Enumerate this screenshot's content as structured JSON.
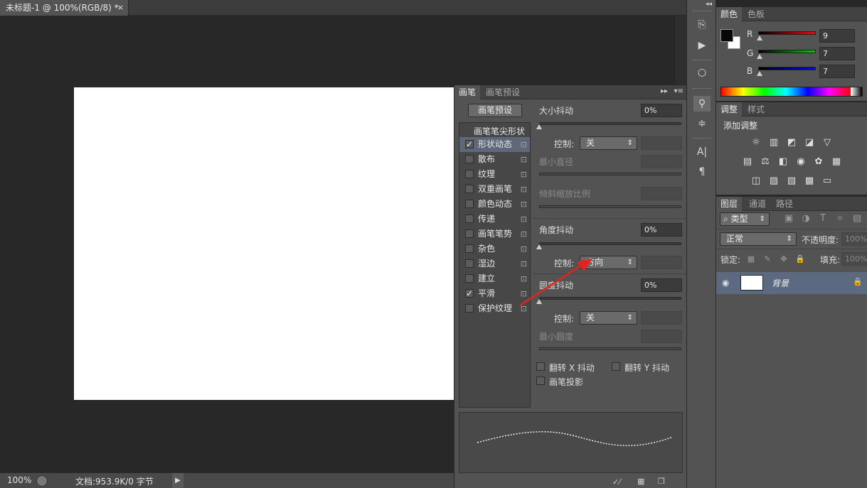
{
  "document": {
    "tab_title": "未标题-1 @ 100%(RGB/8) *",
    "close": "×"
  },
  "status": {
    "zoom": "100%",
    "doc_info": "文档:953.9K/0 字节"
  },
  "brush_panel": {
    "tabs": [
      "画笔",
      "画笔预设"
    ],
    "preset_button": "画笔预设",
    "tip_shape_header": "画笔笔尖形状",
    "items": [
      {
        "label": "形状动态",
        "checked": true,
        "selected": true
      },
      {
        "label": "散布",
        "checked": false
      },
      {
        "label": "纹理",
        "checked": false
      },
      {
        "label": "双重画笔",
        "checked": false
      },
      {
        "label": "颜色动态",
        "checked": false
      },
      {
        "label": "传递",
        "checked": false
      },
      {
        "label": "画笔笔势",
        "checked": false
      },
      {
        "label": "杂色",
        "checked": false
      },
      {
        "label": "湿边",
        "checked": false
      },
      {
        "label": "建立",
        "checked": false
      },
      {
        "label": "平滑",
        "checked": true
      },
      {
        "label": "保护纹理",
        "checked": false
      }
    ],
    "size_jitter_label": "大小抖动",
    "size_jitter_value": "0%",
    "control_label": "控制:",
    "control1_value": "关",
    "min_diameter_label": "最小直径",
    "tilt_scale_label": "倾斜缩放比例",
    "angle_jitter_label": "角度抖动",
    "angle_jitter_value": "0%",
    "control2_value": "方向",
    "roundness_jitter_label": "圆度抖动",
    "roundness_jitter_value": "0%",
    "control3_value": "关",
    "min_roundness_label": "最小圆度",
    "flip_x_label": "翻转 X 抖动",
    "flip_y_label": "翻转 Y 抖动",
    "brush_projection_label": "画笔投影"
  },
  "color_panel": {
    "tabs": [
      "颜色",
      "色板"
    ],
    "r_label": "R",
    "r_value": "9",
    "g_label": "G",
    "g_value": "7",
    "b_label": "B",
    "b_value": "7"
  },
  "adjust_panel": {
    "tabs": [
      "调整",
      "样式"
    ],
    "title": "添加调整"
  },
  "layers_panel": {
    "tabs": [
      "图层",
      "通道",
      "路径"
    ],
    "filter_kind": "类型",
    "blend_mode": "正常",
    "opacity_label": "不透明度:",
    "opacity_value": "100%",
    "lock_label": "锁定:",
    "fill_label": "填充:",
    "fill_value": "100%",
    "layer_name": "背景"
  }
}
